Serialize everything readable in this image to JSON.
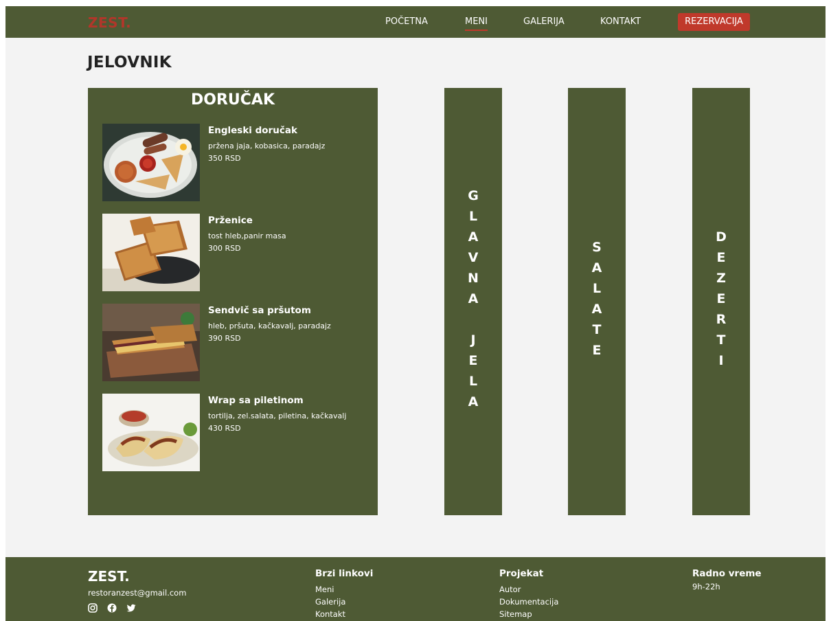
{
  "nav": {
    "logo": "ZEST.",
    "links": [
      "POČETNA",
      "MENI",
      "GALERIJA",
      "KONTAKT"
    ],
    "cta": "REZERVACIJA",
    "active": "MENI"
  },
  "page_title": "JELOVNIK",
  "breakfast": {
    "title": "DORUČAK",
    "items": [
      {
        "name": "Engleski doručak",
        "desc": "pržena jaja, kobasica, paradajz",
        "price": "350 RSD"
      },
      {
        "name": "Prženice",
        "desc": "tost hleb,panir masa",
        "price": "300 RSD"
      },
      {
        "name": "Sendvič sa pršutom",
        "desc": "hleb, pršuta, kačkavalj, paradajz",
        "price": "390 RSD"
      },
      {
        "name": "Wrap sa piletinom",
        "desc": "tortilja, zel.salata, piletina, kačkavalj",
        "price": "430 RSD"
      }
    ]
  },
  "categories": [
    "GLAVNA JELA",
    "SALATE",
    "DEZERTI"
  ],
  "footer": {
    "logo": "ZEST.",
    "email": "restoranzest@gmail.com",
    "social_icons": [
      "instagram-icon",
      "facebook-icon",
      "twitter-icon"
    ],
    "quick_links": {
      "title": "Brzi linkovi",
      "items": [
        "Meni",
        "Galerija",
        "Kontakt"
      ]
    },
    "project": {
      "title": "Projekat",
      "items": [
        "Autor",
        "Dokumentacija",
        "Sitemap"
      ]
    },
    "hours": {
      "title": "Radno vreme",
      "value": "9h-22h"
    }
  },
  "colors": {
    "primary": "#4e5a34",
    "accent": "#c0392b",
    "background": "#f3f3f3"
  }
}
